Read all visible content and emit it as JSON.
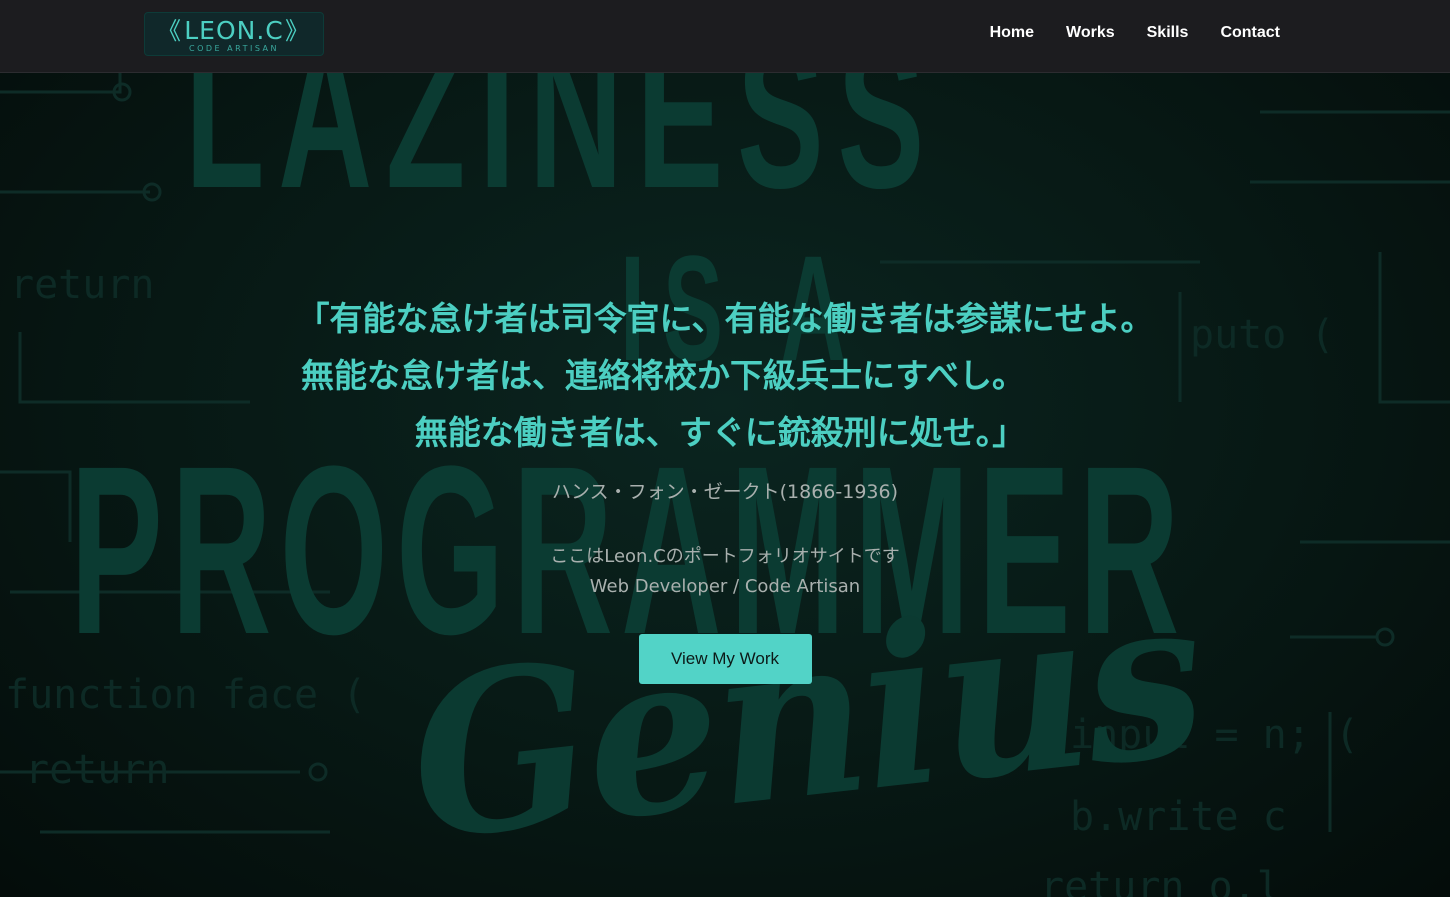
{
  "header": {
    "logo": {
      "name": "LEON.C",
      "subtitle": "CODE ARTISAN",
      "bracket_left": "《",
      "bracket_right": "》"
    },
    "nav": [
      {
        "label": "Home"
      },
      {
        "label": "Works"
      },
      {
        "label": "Skills"
      },
      {
        "label": "Contact"
      }
    ]
  },
  "background": {
    "headline_words": [
      "LAZINESS",
      "IS A",
      "PROGRAMMER",
      "Genius"
    ],
    "code_fragments": [
      "return",
      "function face (",
      "return",
      "input = n; (",
      "b.write c",
      "return o.l",
      "puto ("
    ]
  },
  "hero": {
    "quote_lines": [
      "「有能な怠け者は司令官に、有能な働き者は参謀にせよ。",
      "無能な怠け者は、連絡将校か下級兵士にすべし。",
      "無能な働き者は、すぐに銃殺刑に処せ。」"
    ],
    "attribution": "ハンス・フォン・ゼークト(1866-1936)",
    "intro_line1": "ここはLeon.Cのポートフォリオサイトです",
    "intro_line2": "Web Developer / Code Artisan",
    "cta_label": "View My Work"
  },
  "colors": {
    "accent": "#52d3c7",
    "quote_text": "#4ccfc2",
    "header_bg": "#1c1c1f",
    "page_bg": "#061210",
    "muted_text": "#a9b0ae"
  }
}
